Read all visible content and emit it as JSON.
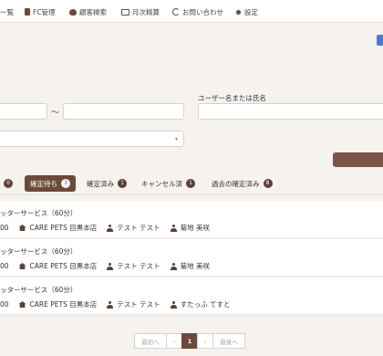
{
  "nav": {
    "items": [
      {
        "label": "一覧",
        "icon": "none"
      },
      {
        "label": "FC管理",
        "icon": "document-icon"
      },
      {
        "label": "顧客検索",
        "icon": "dog-icon"
      },
      {
        "label": "月次精算",
        "icon": "calendar-icon"
      },
      {
        "label": "お問い合わせ",
        "icon": "chat-icon"
      },
      {
        "label": "設定",
        "icon": "gear-icon"
      }
    ]
  },
  "filters": {
    "tilde": "〜",
    "user_label": "ユーザー名または氏名",
    "select_caret": "▾"
  },
  "tabs": [
    {
      "label": "",
      "count": "0"
    },
    {
      "label": "確定待ち",
      "count": "3",
      "active": true
    },
    {
      "label": "確定済み",
      "count": "1"
    },
    {
      "label": "キャンセル済",
      "count": "1"
    },
    {
      "label": "過去の確定済み",
      "count": "8"
    }
  ],
  "reservations": [
    {
      "service": "ッターサービス（60分）",
      "time": "00",
      "store": "CARE PETS 目黒本店",
      "customer": "テスト テスト",
      "staff": "菊地 美咲"
    },
    {
      "service": "ッターサービス（60分）",
      "time": "00",
      "store": "CARE PETS 目黒本店",
      "customer": "テスト テスト",
      "staff": "菊地 美咲"
    },
    {
      "service": "ッターサービス（60分）",
      "time": "00",
      "store": "CARE PETS 目黒本店",
      "customer": "テスト テスト",
      "staff": "すたっふ てすと"
    }
  ],
  "pagination": {
    "first": "最初へ",
    "prev": "‹",
    "current": "1",
    "next": "›",
    "last": "最後へ"
  },
  "colors": {
    "accent": "#6b4a3a",
    "background": "#f6f2ee",
    "blue": "#4a7bd0"
  }
}
